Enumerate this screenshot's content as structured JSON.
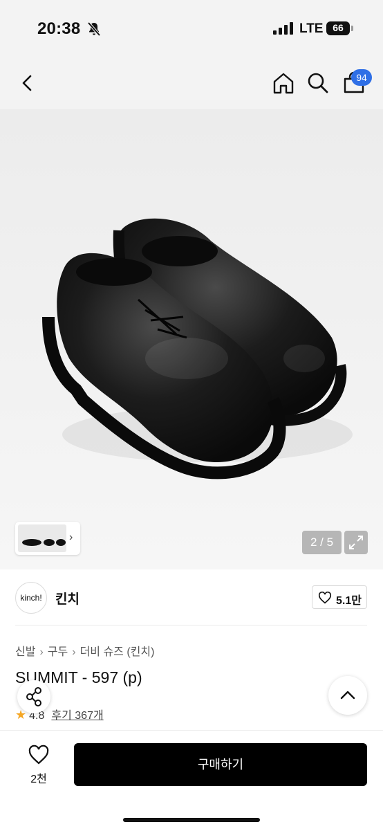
{
  "status_bar": {
    "time": "20:38",
    "network": "LTE",
    "battery": "66"
  },
  "nav": {
    "cart_count": "94"
  },
  "gallery": {
    "pager": "2 / 5"
  },
  "brand": {
    "logo_text": "kinch!",
    "name": "킨치",
    "likes": "5.1만"
  },
  "breadcrumb": [
    "신발",
    "구두",
    "더비 슈즈 (킨치)"
  ],
  "product": {
    "title": "SUMMIT - 597 (p)",
    "rating": "4.8",
    "reviews": "후기 367개"
  },
  "bottom_bar": {
    "wish_count": "2천",
    "buy_label": "구매하기"
  },
  "colors": {
    "accent_badge": "#2f6fe6",
    "buy_button": "#000000",
    "star": "#f5a623"
  }
}
